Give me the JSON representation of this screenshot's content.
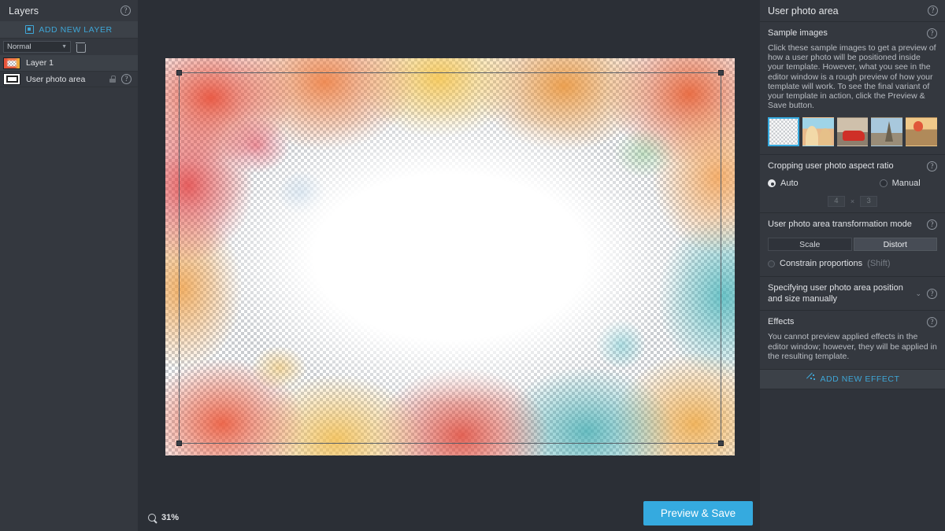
{
  "layers_panel": {
    "title": "Layers",
    "help_icon": "help-icon",
    "add_new_layer_label": "ADD NEW LAYER",
    "blend_mode": "Normal",
    "delete_icon": "trash-icon",
    "layers": [
      {
        "name": "Layer 1",
        "selected": true,
        "locked": false
      },
      {
        "name": "User photo area",
        "selected": false,
        "locked": true
      }
    ]
  },
  "canvas": {
    "zoom_level": "31%",
    "zoom_icon": "magnifier-icon",
    "preview_save_label": "Preview & Save"
  },
  "right_panel": {
    "title": "User photo area",
    "sections": {
      "sample_images": {
        "title": "Sample images",
        "description": "Click these sample images to get a preview of how a user photo will be positioned inside your template. However, what you see in the editor window is a rough preview of how your template will work. To see the final variant of your template in action, click the Preview & Save button.",
        "thumbs": [
          {
            "name": "transparent",
            "selected": true
          },
          {
            "name": "friends-selfie",
            "selected": false
          },
          {
            "name": "red-car",
            "selected": false
          },
          {
            "name": "eiffel-tower",
            "selected": false
          },
          {
            "name": "hot-air-balloon",
            "selected": false
          }
        ]
      },
      "cropping": {
        "title": "Cropping user photo aspect ratio",
        "auto_label": "Auto",
        "manual_label": "Manual",
        "selected": "Auto",
        "ratio_width": "4",
        "ratio_separator": "×",
        "ratio_height": "3",
        "ratio_enabled": false
      },
      "transformation": {
        "title": "User photo area transformation mode",
        "scale_label": "Scale",
        "distort_label": "Distort",
        "active": "Distort",
        "constrain_label": "Constrain proportions",
        "constrain_hint": "(Shift)",
        "constrain_checked": false
      },
      "manual_position": {
        "title": "Specifying user photo area position and size manually",
        "collapsed": true
      },
      "effects": {
        "title": "Effects",
        "description": "You cannot preview applied effects in the editor window; however, they will be applied in the resulting template.",
        "add_effect_label": "ADD NEW EFFECT"
      }
    }
  },
  "colors": {
    "accent_blue": "#3ea6d6",
    "primary_button": "#35aadf",
    "panel_bg": "#34383f",
    "app_bg": "#2b2f36"
  }
}
